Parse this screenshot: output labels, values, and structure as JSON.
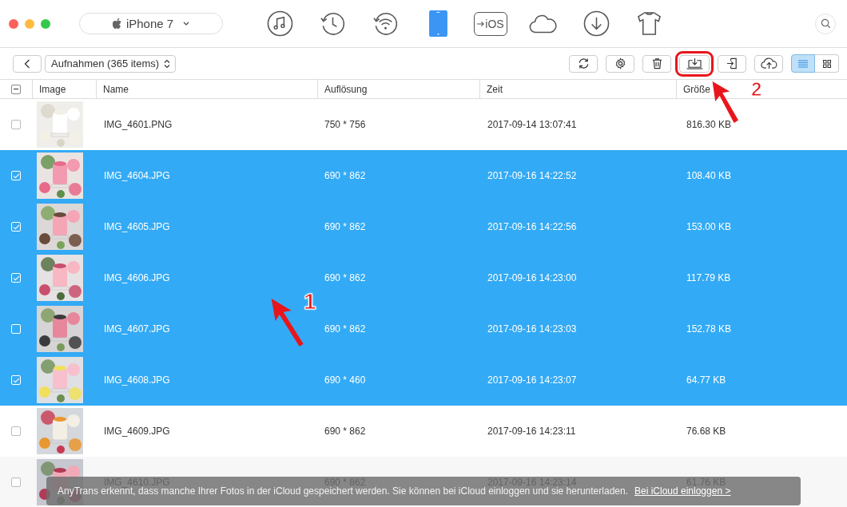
{
  "window": {
    "device": "iPhone 7"
  },
  "nav": [
    {
      "kind": "music",
      "selected": false
    },
    {
      "kind": "history",
      "selected": false
    },
    {
      "kind": "wifi",
      "selected": false
    },
    {
      "kind": "phone",
      "selected": true
    },
    {
      "kind": "ios",
      "label": "iOS",
      "selected": false
    },
    {
      "kind": "cloud",
      "selected": false
    },
    {
      "kind": "download",
      "selected": false
    },
    {
      "kind": "shirt",
      "selected": false
    }
  ],
  "toolbar": {
    "album": "Aufnahmen (365 items)",
    "actions": [
      {
        "kind": "refresh",
        "highlighted": false
      },
      {
        "kind": "settings",
        "highlighted": false
      },
      {
        "kind": "delete",
        "highlighted": false
      },
      {
        "kind": "export",
        "highlighted": true
      },
      {
        "kind": "import",
        "highlighted": false
      },
      {
        "kind": "upload",
        "highlighted": false
      }
    ],
    "views": [
      {
        "kind": "list",
        "selected": true
      },
      {
        "kind": "grid",
        "selected": false
      }
    ]
  },
  "table": {
    "select_all": {
      "mixed": true
    },
    "columns": [
      "Image",
      "Name",
      "Auflösung",
      "Zeit",
      "Größe"
    ],
    "rows": [
      {
        "name": "IMG_4601.PNG",
        "resolution": "750 * 756",
        "time": "2017-09-14 13:07:41",
        "size": "816.30 KB",
        "checked": false,
        "selected": false
      },
      {
        "name": "IMG_4604.JPG",
        "resolution": "690 * 862",
        "time": "2017-09-16 14:22:52",
        "size": "108.40 KB",
        "checked": true,
        "selected": true
      },
      {
        "name": "IMG_4605.JPG",
        "resolution": "690 * 862",
        "time": "2017-09-16 14:22:56",
        "size": "153.00 KB",
        "checked": true,
        "selected": true
      },
      {
        "name": "IMG_4606.JPG",
        "resolution": "690 * 862",
        "time": "2017-09-16 14:23:00",
        "size": "117.79 KB",
        "checked": true,
        "selected": true
      },
      {
        "name": "IMG_4607.JPG",
        "resolution": "690 * 862",
        "time": "2017-09-16 14:23:03",
        "size": "152.78 KB",
        "checked": false,
        "selected": true
      },
      {
        "name": "IMG_4608.JPG",
        "resolution": "690 * 460",
        "time": "2017-09-16 14:23:07",
        "size": "64.77 KB",
        "checked": true,
        "selected": true
      },
      {
        "name": "IMG_4609.JPG",
        "resolution": "690 * 862",
        "time": "2017-09-16 14:23:11",
        "size": "76.68 KB",
        "checked": false,
        "selected": false
      },
      {
        "name": "IMG_4610.JPG",
        "resolution": "690 * 862",
        "time": "2017-09-16 14:23:14",
        "size": "61.76 KB",
        "checked": false,
        "selected": false
      }
    ]
  },
  "notice": {
    "text": "AnyTrans erkennt, dass manche Ihrer Fotos in der iCloud gespeichert werden. Sie können bei iCloud einloggen und sie herunterladen.",
    "link": "Bei iCloud einloggen >"
  },
  "annotations": [
    {
      "label": "1"
    },
    {
      "label": "2"
    }
  ]
}
